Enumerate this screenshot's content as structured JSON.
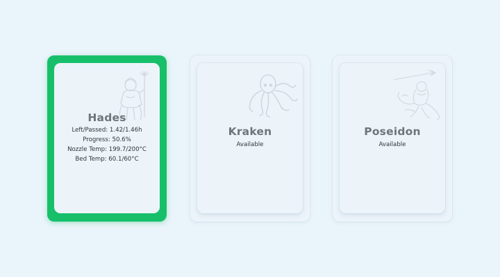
{
  "printers": [
    {
      "name": "Hades",
      "selected": true,
      "lines": [
        "Left/Passed: 1.42/1.46h",
        "Progress: 50.6%",
        "Nozzle Temp: 199.7/200°C",
        "Bed Temp: 60.1/60°C"
      ],
      "art_icon": "hades-figure-icon"
    },
    {
      "name": "Kraken",
      "selected": false,
      "lines": [
        "Available"
      ],
      "art_icon": "octopus-icon"
    },
    {
      "name": "Poseidon",
      "selected": false,
      "lines": [
        "Available"
      ],
      "art_icon": "poseidon-figure-icon"
    }
  ],
  "colors": {
    "background": "#eaf4fb",
    "selected_border": "#17bf6a",
    "name_text": "#6f7579"
  }
}
